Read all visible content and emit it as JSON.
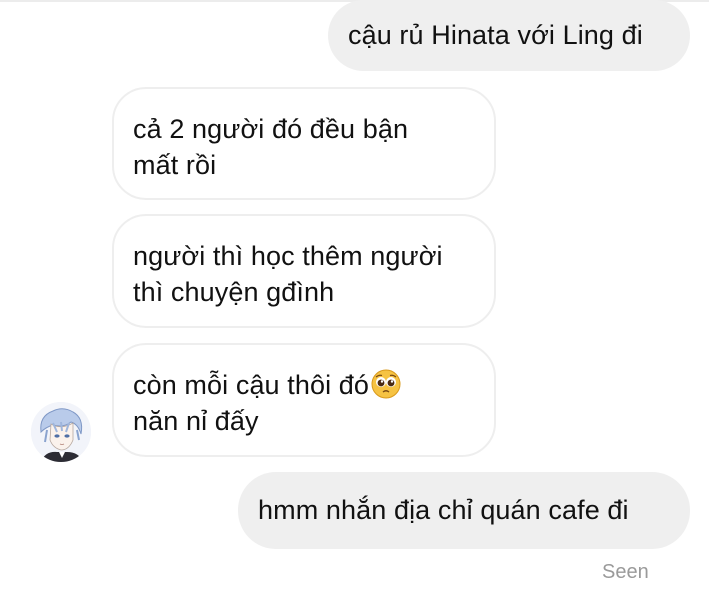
{
  "conversation": {
    "messages": [
      {
        "sender": "me",
        "lines": [
          "cậu rủ Hinata với Ling đi"
        ]
      },
      {
        "sender": "them",
        "lines": [
          "cả 2 người đó đều bận",
          "mất rồi"
        ]
      },
      {
        "sender": "them",
        "lines": [
          "người thì học thêm người",
          "thì chuyện gđình"
        ]
      },
      {
        "sender": "them",
        "lines": [
          "còn mỗi cậu thôi đó",
          "năn nỉ đấy"
        ],
        "emoji": "pleading-face-icon"
      },
      {
        "sender": "me",
        "lines": [
          "hmm nhắn địa chỉ quán cafe đi"
        ]
      }
    ],
    "status": "Seen"
  },
  "colors": {
    "outgoing_bubble": "#efefef",
    "incoming_border": "#eeeeee",
    "status_text": "#9a9a9a"
  },
  "icons": {
    "avatar": "contact-avatar",
    "emoji": "pleading-face-icon"
  }
}
